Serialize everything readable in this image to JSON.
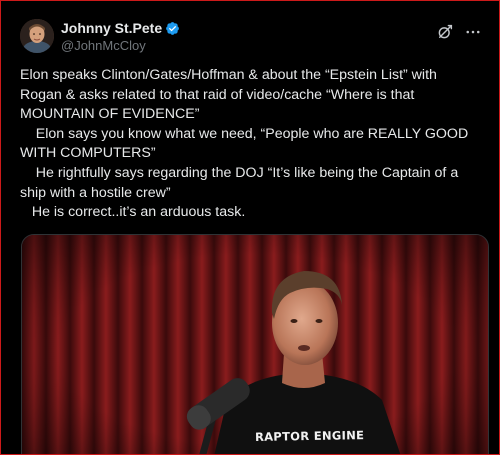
{
  "tweet": {
    "author": {
      "display_name": "Johnny St.Pete",
      "handle": "@JohnMcCloy",
      "verified": true
    },
    "text": "Elon speaks Clinton/Gates/Hoffman & about the “Epstein List” with Rogan & asks related to that raid of video/cache “Where is that MOUNTAIN OF EVIDENCE”\n    Elon says you know what we need, “People who are REALLY GOOD WITH COMPUTERS”\n    He rightfully says regarding the DOJ “It’s like being the Captain of a ship with a hostile crew”\n   He is correct..it’s an arduous task.",
    "media": {
      "shirt_text": "RAPTOR ENGINE"
    }
  },
  "icons": {
    "verified": "verified-badge-icon",
    "grok": "grok-icon",
    "more": "more-icon"
  },
  "colors": {
    "background": "#000000",
    "text": "#e7e9ea",
    "secondary_text": "#71767b",
    "verified_blue": "#1d9bf0",
    "frame_border": "#cc1a1a"
  }
}
